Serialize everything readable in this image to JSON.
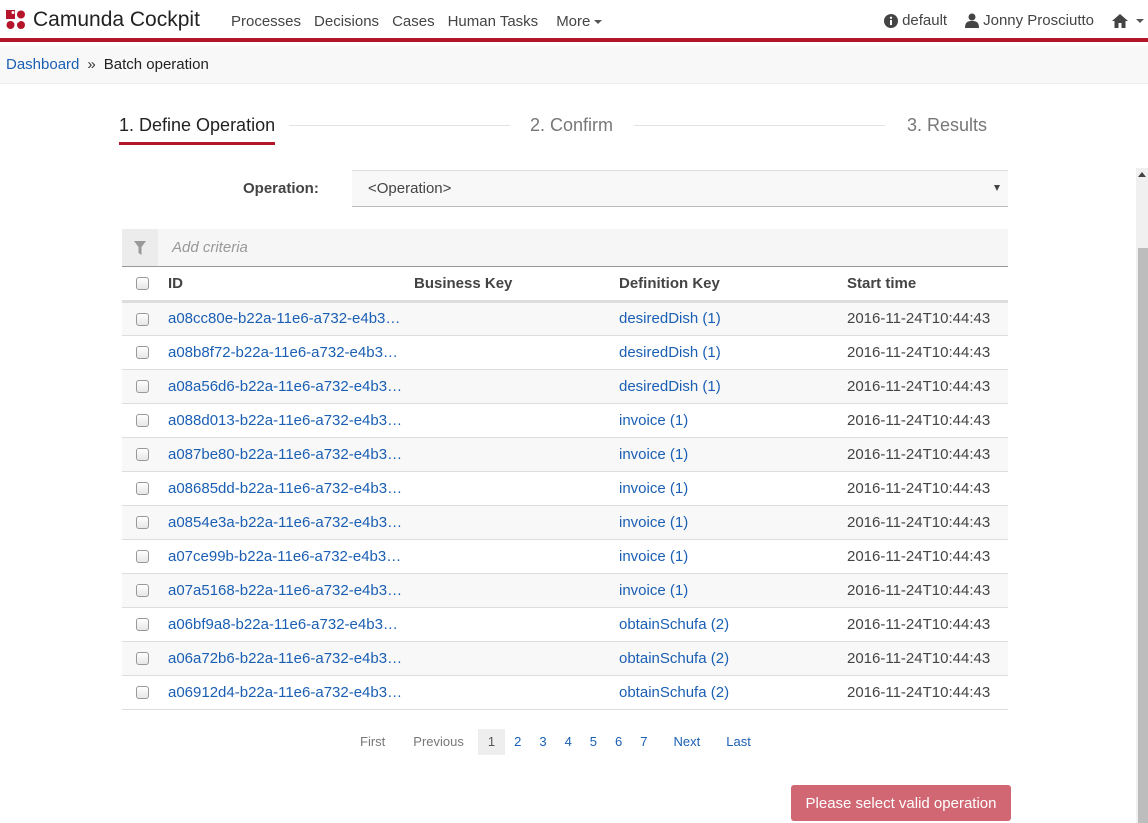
{
  "app": {
    "title": "Camunda Cockpit",
    "nav": [
      "Processes",
      "Decisions",
      "Cases",
      "Human Tasks"
    ],
    "more_label": "More",
    "engine_label": "default",
    "user_label": "Jonny Prosciutto",
    "brand_color": "#b5152b"
  },
  "breadcrumb": {
    "link": "Dashboard",
    "separator": "»",
    "current": "Batch operation"
  },
  "steps": [
    {
      "label": "1. Define Operation",
      "active": true
    },
    {
      "label": "2. Confirm",
      "active": false
    },
    {
      "label": "3. Results",
      "active": false
    }
  ],
  "operation": {
    "label": "Operation:",
    "selected": "<Operation>"
  },
  "filter": {
    "placeholder": "Add criteria"
  },
  "table": {
    "headers": {
      "id": "ID",
      "business_key": "Business Key",
      "definition_key": "Definition Key",
      "start_time": "Start time"
    },
    "rows": [
      {
        "id": "a08cc80e-b22a-11e6-a732-e4b3…",
        "business_key": "",
        "definition_key": "desiredDish (1)",
        "start_time": "2016-11-24T10:44:43"
      },
      {
        "id": "a08b8f72-b22a-11e6-a732-e4b3…",
        "business_key": "",
        "definition_key": "desiredDish (1)",
        "start_time": "2016-11-24T10:44:43"
      },
      {
        "id": "a08a56d6-b22a-11e6-a732-e4b3…",
        "business_key": "",
        "definition_key": "desiredDish (1)",
        "start_time": "2016-11-24T10:44:43"
      },
      {
        "id": "a088d013-b22a-11e6-a732-e4b3…",
        "business_key": "",
        "definition_key": "invoice (1)",
        "start_time": "2016-11-24T10:44:43"
      },
      {
        "id": "a087be80-b22a-11e6-a732-e4b3…",
        "business_key": "",
        "definition_key": "invoice (1)",
        "start_time": "2016-11-24T10:44:43"
      },
      {
        "id": "a08685dd-b22a-11e6-a732-e4b3…",
        "business_key": "",
        "definition_key": "invoice (1)",
        "start_time": "2016-11-24T10:44:43"
      },
      {
        "id": "a0854e3a-b22a-11e6-a732-e4b3…",
        "business_key": "",
        "definition_key": "invoice (1)",
        "start_time": "2016-11-24T10:44:43"
      },
      {
        "id": "a07ce99b-b22a-11e6-a732-e4b3…",
        "business_key": "",
        "definition_key": "invoice (1)",
        "start_time": "2016-11-24T10:44:43"
      },
      {
        "id": "a07a5168-b22a-11e6-a732-e4b3…",
        "business_key": "",
        "definition_key": "invoice (1)",
        "start_time": "2016-11-24T10:44:43"
      },
      {
        "id": "a06bf9a8-b22a-11e6-a732-e4b3…",
        "business_key": "",
        "definition_key": "obtainSchufa (2)",
        "start_time": "2016-11-24T10:44:43"
      },
      {
        "id": "a06a72b6-b22a-11e6-a732-e4b3…",
        "business_key": "",
        "definition_key": "obtainSchufa (2)",
        "start_time": "2016-11-24T10:44:43"
      },
      {
        "id": "a06912d4-b22a-11e6-a732-e4b3…",
        "business_key": "",
        "definition_key": "obtainSchufa (2)",
        "start_time": "2016-11-24T10:44:43"
      }
    ]
  },
  "pagination": {
    "first": "First",
    "previous": "Previous",
    "pages": [
      "1",
      "2",
      "3",
      "4",
      "5",
      "6",
      "7"
    ],
    "current": "1",
    "next": "Next",
    "last": "Last"
  },
  "submit_button": {
    "label": "Please select valid operation",
    "color": "#d06773"
  }
}
